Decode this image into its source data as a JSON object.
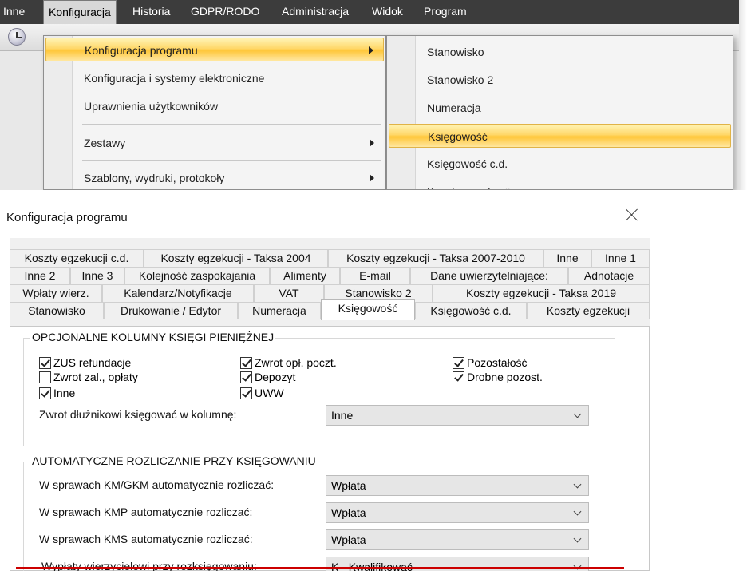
{
  "menubar": {
    "items": [
      "Inne",
      "Konfiguracja",
      "Historia",
      "GDPR/RODO",
      "Administracja",
      "Widok",
      "Program"
    ],
    "active_index": 1
  },
  "menu_primary": {
    "items": [
      {
        "label": "Konfiguracja programu",
        "submenu": true,
        "highlighted": true
      },
      {
        "label": "Konfiguracja i systemy elektroniczne",
        "submenu": false
      },
      {
        "label": "Uprawnienia użytkowników",
        "submenu": false
      },
      {
        "label": "Zestawy",
        "submenu": true
      },
      {
        "label": "Szablony, wydruki, protokoły",
        "submenu": true
      }
    ]
  },
  "menu_secondary": {
    "items": [
      {
        "label": "Stanowisko"
      },
      {
        "label": "Stanowisko 2"
      },
      {
        "label": "Numeracja"
      },
      {
        "label": "Księgowość",
        "highlighted": true
      },
      {
        "label": "Księgowość c.d."
      },
      {
        "label": "Koszty egzekucji"
      }
    ]
  },
  "dialog": {
    "title": "Konfiguracja programu",
    "close_icon": "close-icon"
  },
  "tabs": {
    "row1": [
      "Koszty egzekucji c.d.",
      "Koszty egzekucji - Taksa 2004",
      "Koszty egzekucji - Taksa 2007-2010",
      "Inne",
      "Inne 1"
    ],
    "row2": [
      "Inne 2",
      "Inne 3",
      "Kolejność zaspokajania",
      "Alimenty",
      "E-mail",
      "Dane uwierzytelniające:",
      "Adnotacje"
    ],
    "row3": [
      "Wpłaty wierz.",
      "Kalendarz/Notyfikacje",
      "VAT",
      "Stanowisko 2",
      "Koszty egzekucji - Taksa 2019"
    ],
    "row4": [
      "Stanowisko",
      "Drukowanie / Edytor",
      "Numeracja",
      "Księgowość",
      "Księgowość c.d.",
      "Koszty egzekucji"
    ],
    "selected": "Księgowość"
  },
  "group_columns": {
    "title": "OPCJONALNE KOLUMNY KSIĘGI PIENIĘŻNEJ",
    "checkboxes": [
      {
        "label": "ZUS refundacje",
        "checked": true
      },
      {
        "label": "Zwrot zal., opłaty",
        "checked": false
      },
      {
        "label": "Inne",
        "checked": true
      },
      {
        "label": "Zwrot opł. poczt.",
        "checked": true
      },
      {
        "label": "Depozyt",
        "checked": true
      },
      {
        "label": "UWW",
        "checked": true
      },
      {
        "label": "Pozostałość",
        "checked": true
      },
      {
        "label": "Drobne pozost.",
        "checked": true
      }
    ],
    "refund_label": "Zwrot dłużnikowi księgować w kolumnę:",
    "refund_value": "Inne"
  },
  "group_auto": {
    "title": "AUTOMATYCZNE ROZLICZANIE PRZY KSIĘGOWANIU",
    "rows": [
      {
        "label": "W sprawach KM/GKM automatycznie rozliczać:",
        "value": "Wpłata"
      },
      {
        "label": "W sprawach KMP automatycznie rozliczać:",
        "value": "Wpłata"
      },
      {
        "label": "W sprawach KMS automatycznie rozliczać:",
        "value": "Wpłata"
      },
      {
        "label": "Wypłaty wierzycielowi przy rozksięgowaniu:",
        "value": "K - Kwalifikować"
      }
    ]
  },
  "colors": {
    "menubar_bg": "#3c3c3c",
    "highlight": "#ffc73a",
    "underline": "#cc0000"
  }
}
